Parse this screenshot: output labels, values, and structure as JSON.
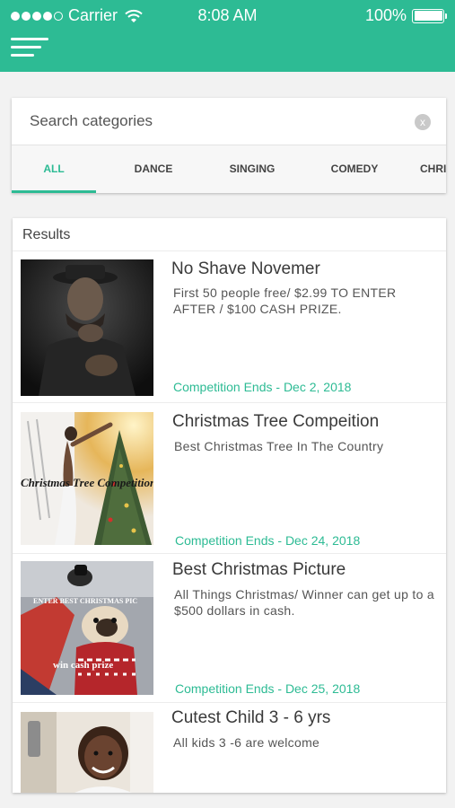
{
  "status_bar": {
    "carrier": "Carrier",
    "time": "8:08 AM",
    "battery": "100%",
    "battery_level": 1.0
  },
  "header": {
    "menu_icon": "hamburger-menu-icon",
    "accent": "#2dbb94"
  },
  "search": {
    "placeholder": "Search categories",
    "value": "",
    "clear_label": "x"
  },
  "tabs": [
    {
      "label": "ALL",
      "active": true
    },
    {
      "label": "DANCE",
      "active": false
    },
    {
      "label": "SINGING",
      "active": false
    },
    {
      "label": "COMEDY",
      "active": false
    },
    {
      "label": "CHRI",
      "active": false
    }
  ],
  "results": {
    "heading": "Results",
    "items": [
      {
        "title": "No Shave Novemer",
        "description": "First 50 people free/ $2.99 TO ENTER AFTER / $100 CASH PRIZE.",
        "ends": "Competition Ends - Dec 2, 2018",
        "image_text": ""
      },
      {
        "title": "Christmas Tree Compeition",
        "description": "Best Christmas Tree In The Country",
        "ends": "Competition Ends - Dec 24, 2018",
        "image_text": "Christmas Tree Competition"
      },
      {
        "title": "Best Christmas Picture",
        "description": "All Things Christmas/ Winner can get up to a $500 dollars in cash.",
        "ends": "Competition Ends - Dec 25, 2018",
        "image_text_top": "ENTER BEST CHRISTMAS PIC",
        "image_text_bottom": "win cash prize"
      },
      {
        "title": "Cutest Child 3 - 6 yrs",
        "description": "All kids 3 -6 are welcome",
        "ends": "",
        "image_text": ""
      }
    ]
  }
}
